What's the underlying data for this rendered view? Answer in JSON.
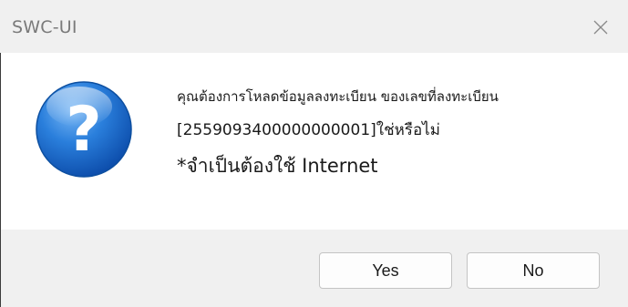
{
  "window": {
    "title": "SWC-UI",
    "close_icon": "close-icon"
  },
  "message": {
    "icon": "question-icon",
    "line1": "คุณต้องการโหลดข้อมูลลงทะเบียน ของเลขที่ลงทะเบียน",
    "line2": "[2559093400000000001]ใช่หรือไม่",
    "line3": "*จำเป็นต้องใช้ Internet"
  },
  "buttons": {
    "yes_label": "Yes",
    "no_label": "No"
  },
  "colors": {
    "titlebar": "#f0f0f0",
    "footer": "#f0f0f0",
    "icon_blue": "#1e73d2"
  }
}
